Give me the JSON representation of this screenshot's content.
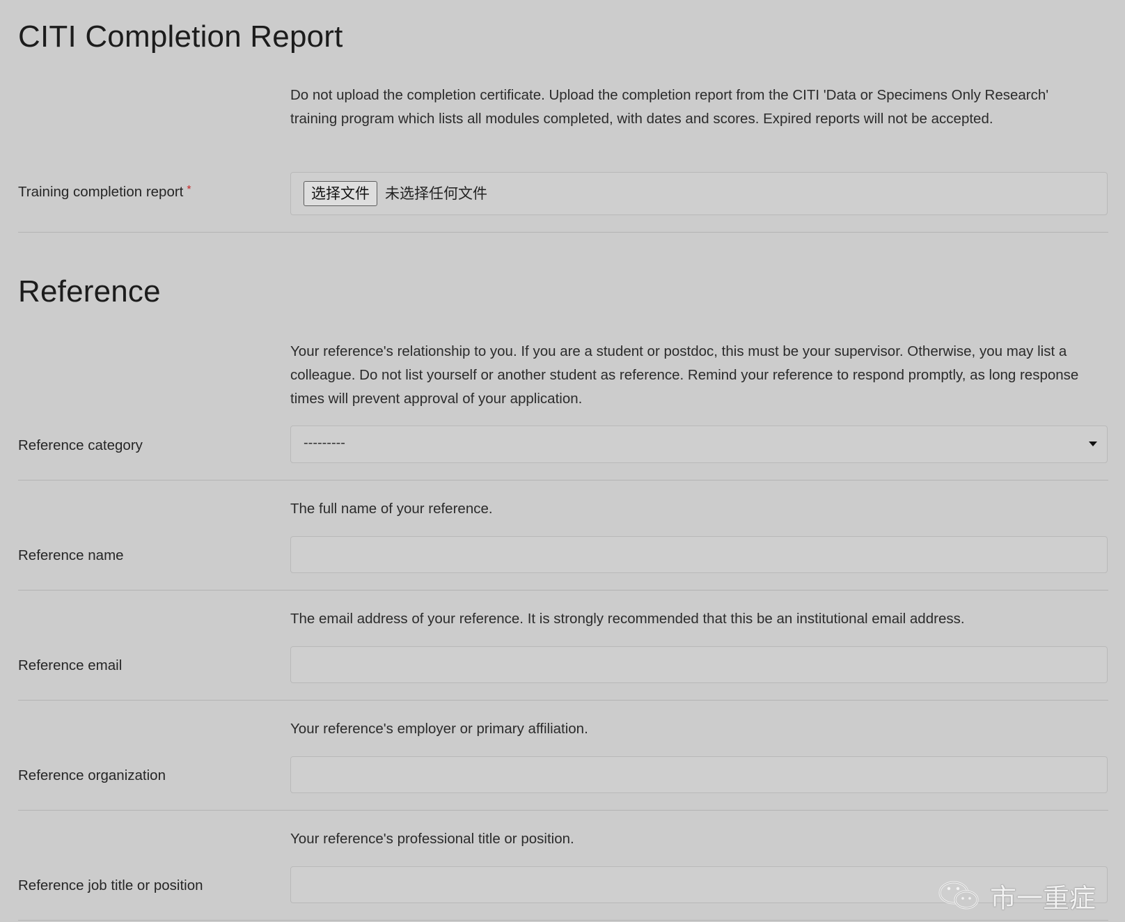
{
  "citi": {
    "heading": "CITI Completion Report",
    "help": "Do not upload the completion certificate. Upload the completion report from the CITI 'Data or Specimens Only Research' training program which lists all modules completed, with dates and scores. Expired reports will not be accepted.",
    "label": "Training completion report",
    "required_mark": "*",
    "file_button": "选择文件",
    "file_status": "未选择任何文件"
  },
  "reference": {
    "heading": "Reference",
    "category": {
      "help": "Your reference's relationship to you. If you are a student or postdoc, this must be your supervisor. Otherwise, you may list a colleague. Do not list yourself or another student as reference. Remind your reference to respond promptly, as long response times will prevent approval of your application.",
      "label": "Reference category",
      "selected": "---------"
    },
    "name": {
      "help": "The full name of your reference.",
      "label": "Reference name",
      "value": ""
    },
    "email": {
      "help": "The email address of your reference. It is strongly recommended that this be an institutional email address.",
      "label": "Reference email",
      "value": ""
    },
    "organization": {
      "help": "Your reference's employer or primary affiliation.",
      "label": "Reference organization",
      "value": ""
    },
    "job_title": {
      "help": "Your reference's professional title or position.",
      "label": "Reference job title or position",
      "value": ""
    }
  },
  "watermark": {
    "text": "市一重症",
    "icon": "wechat-icon"
  }
}
